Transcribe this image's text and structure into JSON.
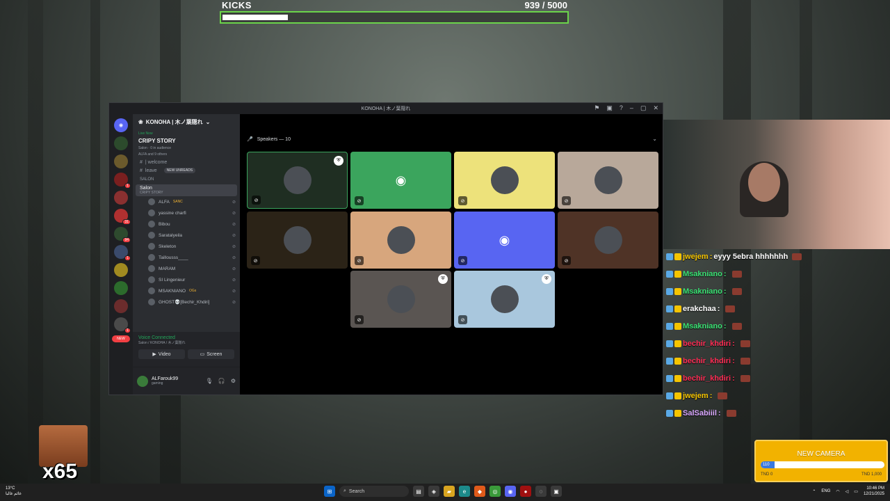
{
  "kicks": {
    "title": "KICKS",
    "count": "939  / 5000",
    "progress": 0.188
  },
  "discord": {
    "window_title": "KONOHA | 木ノ葉隠れ",
    "server_name": "KONOHA | 木ノ葉隠れ",
    "live_now": "Live Now",
    "stage_title": "CRIPY STORY",
    "stage_sub": "Salon · 0 in audience",
    "stage_members": "ALFA and 9 others",
    "channel_welcome": "| welcome",
    "channel_leave": "leave",
    "new_unreads": "NEW UNREADS",
    "category": "SALON",
    "voice_channel": "Salon",
    "voice_channel_sub": "CRIPY STORY",
    "members": [
      {
        "name": "ALFA",
        "extra": "SANC"
      },
      {
        "name": "yassine charfi",
        "extra": ""
      },
      {
        "name": "Bibou",
        "extra": ""
      },
      {
        "name": "Saratalyeila",
        "extra": ""
      },
      {
        "name": "Skeleton",
        "extra": ""
      },
      {
        "name": "Taillousss____",
        "extra": ""
      },
      {
        "name": "MARAM",
        "extra": ""
      },
      {
        "name": "SI Lingenieur",
        "extra": ""
      },
      {
        "name": "MSAKNIANO",
        "extra": "OGs"
      },
      {
        "name": "GHOST💀[Bechir_Khdiri]",
        "extra": ""
      }
    ],
    "new_badge": "NEW",
    "voice_connected": "Voice Connected",
    "voice_connected_sub": "Salon / KONOHA / 木ノ葉隠れ",
    "video_label": "Video",
    "screen_label": "Screen",
    "username": "ALFarouk99",
    "user_status": "gaming",
    "speakers_label": "Speakers — 10",
    "tiles": [
      {
        "color": "#1f2e22",
        "shield": true
      },
      {
        "color": "#3ba55d",
        "shield": false
      },
      {
        "color": "#ede27b",
        "shield": false
      },
      {
        "color": "#b8a89a",
        "shield": false
      },
      {
        "color": "#2b2317",
        "shield": false
      },
      {
        "color": "#d7a67d",
        "shield": false
      },
      {
        "color": "#5865f2",
        "shield": false
      },
      {
        "color": "#4f3326",
        "shield": false
      },
      {
        "color": "#5a5552",
        "shield": true
      },
      {
        "color": "#a9c7dd",
        "shield": true
      }
    ]
  },
  "chat": [
    {
      "user": "jwejem",
      "text": "eyyy 5ebra hhhhhhh",
      "color": "#f5c400"
    },
    {
      "user": "Msakniano",
      "text": "",
      "color": "#3ae374"
    },
    {
      "user": "Msakniano",
      "text": "",
      "color": "#3ae374"
    },
    {
      "user": "erakchaa",
      "text": "",
      "color": "#ffffff"
    },
    {
      "user": "Msakniano",
      "text": "",
      "color": "#3ae374"
    },
    {
      "user": "bechir_khdiri",
      "text": "",
      "color": "#ff2d55"
    },
    {
      "user": "bechir_khdiri",
      "text": "",
      "color": "#ff2d55"
    },
    {
      "user": "bechir_khdiri",
      "text": "",
      "color": "#ff2d55"
    },
    {
      "user": "jwejem",
      "text": "",
      "color": "#f5c400"
    },
    {
      "user": "SalSabiiil",
      "text": "",
      "color": "#d9a7ff"
    }
  ],
  "reaction": {
    "multiplier": "x65"
  },
  "goal": {
    "title": "NEW CAMERA",
    "progress_label": "110",
    "progress": 0.11,
    "left": "TND 0",
    "right": "TND 1,000"
  },
  "taskbar": {
    "temp": "13°C",
    "weather": "غائم غالبا",
    "search": "Search",
    "lang": "ENG",
    "time": "10:46 PM",
    "date": "12/21/2025"
  }
}
